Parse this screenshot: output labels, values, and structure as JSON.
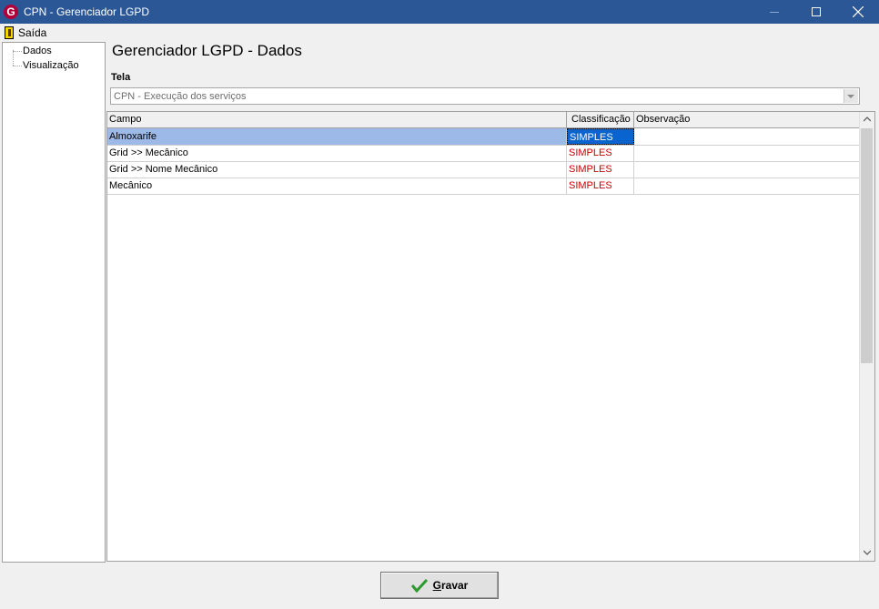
{
  "window": {
    "title": "CPN - Gerenciador LGPD",
    "app_icon_letter": "G"
  },
  "menu": {
    "items": [
      {
        "label": "Saída",
        "icon": "exit-door-icon"
      }
    ]
  },
  "tree": {
    "items": [
      {
        "label": "Dados"
      },
      {
        "label": "Visualização"
      }
    ]
  },
  "page": {
    "title": "Gerenciador LGPD - Dados"
  },
  "tela": {
    "label": "Tela",
    "value": "CPN - Execução dos serviços"
  },
  "grid": {
    "columns": [
      "Campo",
      "Classificação",
      "Observação"
    ],
    "rows": [
      {
        "campo": "Almoxarife",
        "classificacao": "SIMPLES",
        "observacao": "",
        "selected": true
      },
      {
        "campo": "Grid >> Mecânico",
        "classificacao": "SIMPLES",
        "observacao": ""
      },
      {
        "campo": "Grid >> Nome Mecânico",
        "classificacao": "SIMPLES",
        "observacao": ""
      },
      {
        "campo": "Mecânico",
        "classificacao": "SIMPLES",
        "observacao": ""
      }
    ]
  },
  "actions": {
    "gravar_first": "G",
    "gravar_rest": "ravar",
    "gravar_icon": "check-icon"
  },
  "colors": {
    "titlebar": "#2b5797",
    "selected_row": "#9db9e8",
    "classification_text": "#cc0000",
    "check": "#2e9a2e"
  }
}
